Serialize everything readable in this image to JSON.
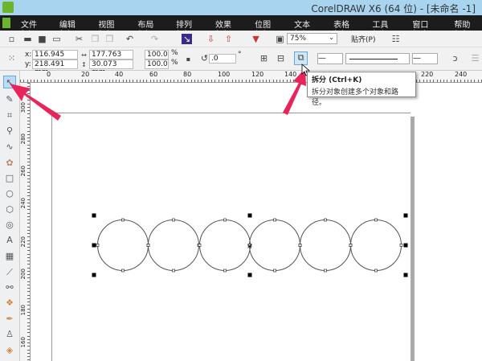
{
  "window": {
    "title": "CorelDRAW X6 (64 位) - [未命名 -1]"
  },
  "menu": [
    "文件(F)",
    "编辑(E)",
    "视图(V)",
    "布局(L)",
    "排列(A)",
    "效果(C)",
    "位图(B)",
    "文本(X)",
    "表格(T)",
    "工具(O)",
    "窗口(W)",
    "帮助(H)"
  ],
  "toolbar": {
    "zoom": "75%",
    "snap": "贴齐(P)"
  },
  "props": {
    "x": "116.945 mm",
    "y": "218.491 mm",
    "w": "177.763 mm",
    "h": "30.073 mm",
    "sx": "100.0",
    "sy": "100.0",
    "pct": "%",
    "angle": ".0",
    "deg": "°",
    "x_label": "x:",
    "y_label": "y:"
  },
  "tooltip": {
    "title": "拆分 (Ctrl+K)",
    "desc": "拆分对象创建多个对象和路径。"
  },
  "ruler_top": [
    "0",
    "20",
    "40",
    "60",
    "80",
    "100",
    "120",
    "140",
    "220",
    "240"
  ],
  "ruler_left": [
    "300",
    "280",
    "260",
    "240",
    "220",
    "200",
    "180",
    "160"
  ],
  "accent": "#e8245a"
}
